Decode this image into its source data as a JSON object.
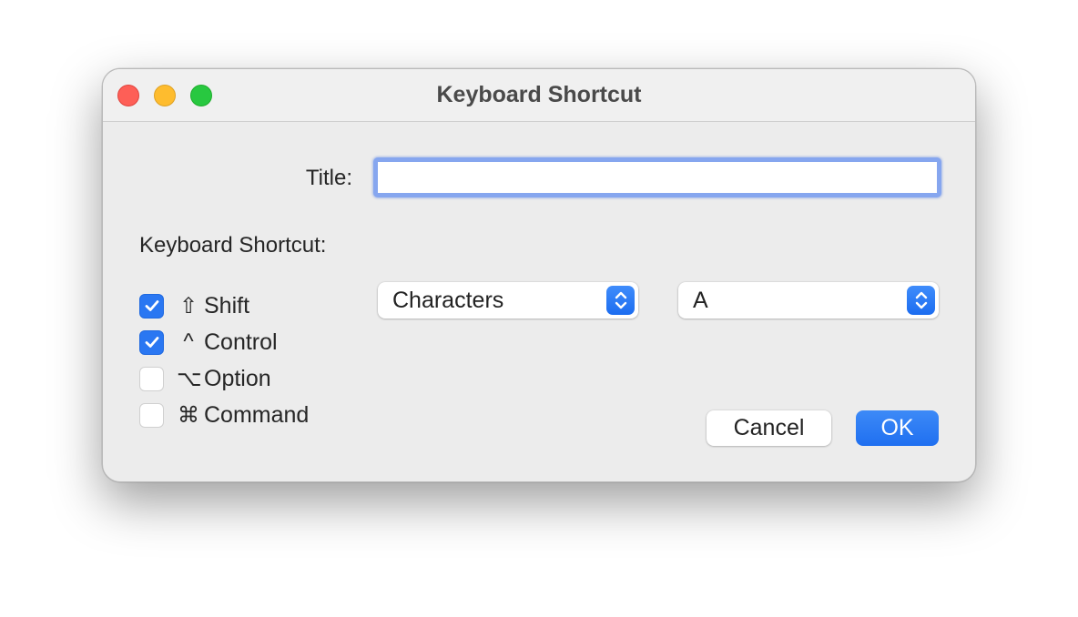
{
  "window": {
    "title": "Keyboard Shortcut",
    "controls": {
      "close_color": "#fe5f57",
      "minimize_color": "#febc2e",
      "zoom_color": "#28c840"
    }
  },
  "form": {
    "title_label": "Title:",
    "title_value": "",
    "title_placeholder": "",
    "shortcut_label": "Keyboard Shortcut:",
    "modifiers": [
      {
        "symbol": "⇧",
        "name": "Shift",
        "checked": true
      },
      {
        "symbol": "^",
        "name": "Control",
        "checked": true
      },
      {
        "symbol": "⌥",
        "name": "Option",
        "checked": false
      },
      {
        "symbol": "⌘",
        "name": "Command",
        "checked": false
      }
    ],
    "key_type_select": {
      "value": "Characters"
    },
    "key_select": {
      "value": "A"
    }
  },
  "buttons": {
    "cancel": "Cancel",
    "ok": "OK"
  },
  "colors": {
    "accent": "#2a77f2",
    "focus_ring": "#86a6ef"
  }
}
